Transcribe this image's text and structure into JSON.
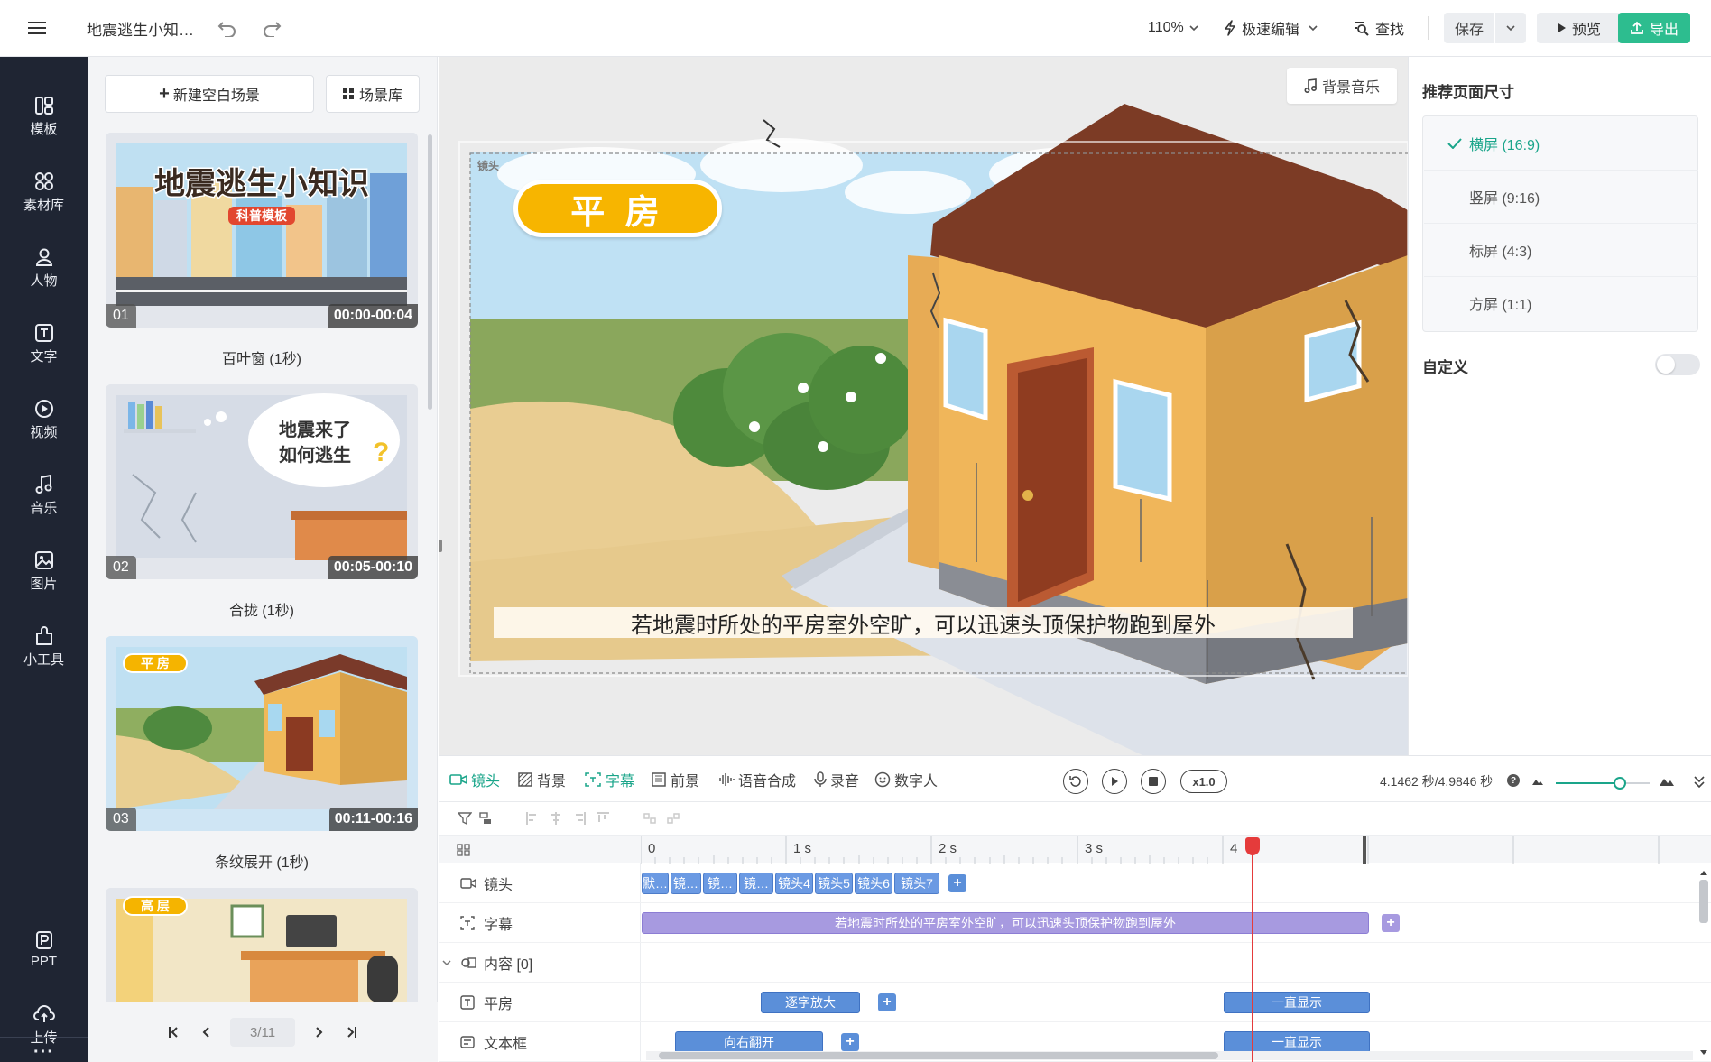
{
  "header": {
    "doc_title": "地震逃生小知…",
    "zoom": "110%",
    "edit_mode": "极速编辑",
    "find_label": "查找",
    "save_label": "保存",
    "preview_label": "预览",
    "export_label": "导出"
  },
  "sidebar": {
    "items": [
      {
        "label": "模板",
        "icon": "template-icon"
      },
      {
        "label": "素材库",
        "icon": "assets-icon"
      },
      {
        "label": "人物",
        "icon": "person-icon"
      },
      {
        "label": "文字",
        "icon": "text-icon"
      },
      {
        "label": "视频",
        "icon": "video-icon"
      },
      {
        "label": "音乐",
        "icon": "music-icon"
      },
      {
        "label": "图片",
        "icon": "image-icon"
      },
      {
        "label": "小工具",
        "icon": "tools-icon"
      }
    ],
    "bottom": [
      {
        "label": "PPT",
        "icon": "ppt-icon"
      },
      {
        "label": "上传",
        "icon": "upload-icon"
      }
    ],
    "more": "···"
  },
  "scene_panel": {
    "new_scene": "新建空白场景",
    "library": "场景库",
    "scenes": [
      {
        "num": "01",
        "duration": "00:00-00:04",
        "caption": "百叶窗 (1秒)",
        "title": "地震逃生小知识",
        "tag": "科普模板"
      },
      {
        "num": "02",
        "duration": "00:05-00:10",
        "caption": "合拢 (1秒)",
        "bubble_line1": "地震来了",
        "bubble_line2": "如何逃生"
      },
      {
        "num": "03",
        "duration": "00:11-00:16",
        "caption": "条纹展开 (1秒)",
        "badge": "平 房"
      },
      {
        "badge": "高 层"
      }
    ],
    "pager": "3/11"
  },
  "canvas": {
    "bg_music": "背景音乐",
    "badge": "平 房",
    "subtitle": "若地震时所处的平房室外空旷，可以迅速头顶保护物跑到屋外",
    "corner_label": "镜头"
  },
  "right_panel": {
    "title": "推荐页面尺寸",
    "sizes": [
      {
        "label": "横屏 (16:9)",
        "selected": true
      },
      {
        "label": "竖屏 (9:16)",
        "selected": false
      },
      {
        "label": "标屏 (4:3)",
        "selected": false
      },
      {
        "label": "方屏 (1:1)",
        "selected": false
      }
    ],
    "custom_label": "自定义",
    "custom_enabled": false
  },
  "timeline": {
    "tabs": [
      "镜头",
      "背景",
      "字幕",
      "前景",
      "语音合成",
      "录音",
      "数字人"
    ],
    "active_tabs": [
      "镜头",
      "字幕"
    ],
    "speed": "x1.0",
    "time_readout": "4.1462 秒/4.9846 秒",
    "playhead_seconds": 4.1462,
    "total_seconds": 4.9846,
    "zoom_level": 0.7,
    "ruler": [
      "0",
      "1 s",
      "2 s",
      "3 s",
      "4"
    ],
    "rows": [
      {
        "label": "镜头",
        "icon": "camera-icon"
      },
      {
        "label": "字幕",
        "icon": "subtitle-icon"
      },
      {
        "label": "内容 [0]",
        "icon": "content-icon"
      },
      {
        "label": "平房",
        "icon": "text-box-icon"
      },
      {
        "label": "文本框",
        "icon": "textframe-icon"
      }
    ],
    "shot_clips": [
      "默…",
      "镜…",
      "镜…",
      "镜…",
      "镜头4",
      "镜头5",
      "镜头6",
      "镜头7"
    ],
    "subtitle_clip": "若地震时所处的平房室外空旷，可以迅速头顶保护物跑到屋外",
    "pingfang_clips": [
      "逐字放大",
      "一直显示"
    ],
    "textbox_clips": [
      "向右翻开",
      "一直显示"
    ]
  },
  "colors": {
    "accent": "#1aa58a",
    "sidebar_bg": "#1f2533",
    "export_btn": "#2dbd8f",
    "clip_blue": "#5b8fd9",
    "clip_purple": "#a79ae0",
    "playhead": "#e53b3b"
  }
}
